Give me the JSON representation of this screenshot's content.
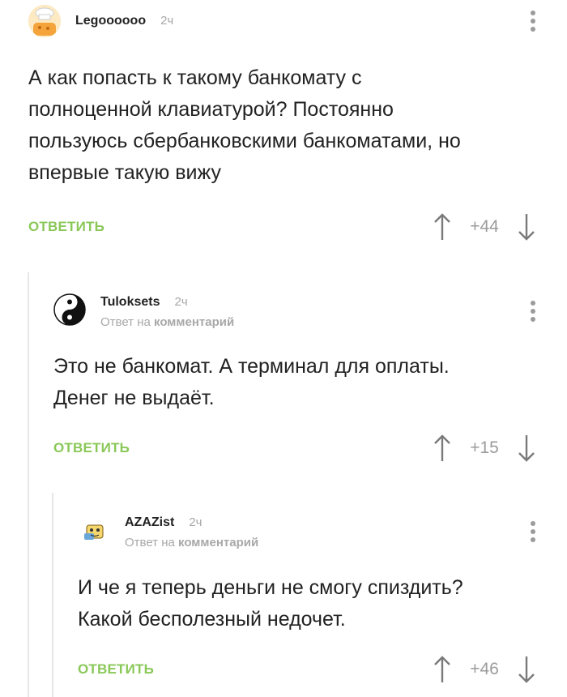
{
  "comments": [
    {
      "username": "Legoooooo",
      "time": "2ч",
      "text_lines": [
        "А как попасть к такому банкомату с",
        "полноценной клавиатурой? Постоянно",
        "пользуюсь сбербанковскими банкоматами, но",
        "впервые такую вижу"
      ],
      "reply_label": "ОТВЕТИТЬ",
      "score": "+44"
    },
    {
      "username": "Tuloksets",
      "time": "2ч",
      "reply_prefix": "Ответ на",
      "reply_target": "комментарий",
      "text_lines": [
        "Это не банкомат. А терминал для оплаты.",
        "Денег не выдаёт."
      ],
      "reply_label": "ОТВЕТИТЬ",
      "score": "+15"
    },
    {
      "username": "AZAZist",
      "time": "2ч",
      "reply_prefix": "Ответ на",
      "reply_target": "комментарий",
      "text_lines": [
        "И че я теперь деньги не смогу спиздить?",
        "Какой бесполезный недочет."
      ],
      "reply_label": "ОТВЕТИТЬ",
      "score": "+46"
    }
  ],
  "colors": {
    "accent_green": "#8ac858",
    "muted": "#a8a8a8",
    "thread_line": "#e6e6e6"
  },
  "icons": {
    "up": "arrow-up-icon",
    "down": "arrow-down-icon",
    "menu": "kebab-menu-icon"
  }
}
